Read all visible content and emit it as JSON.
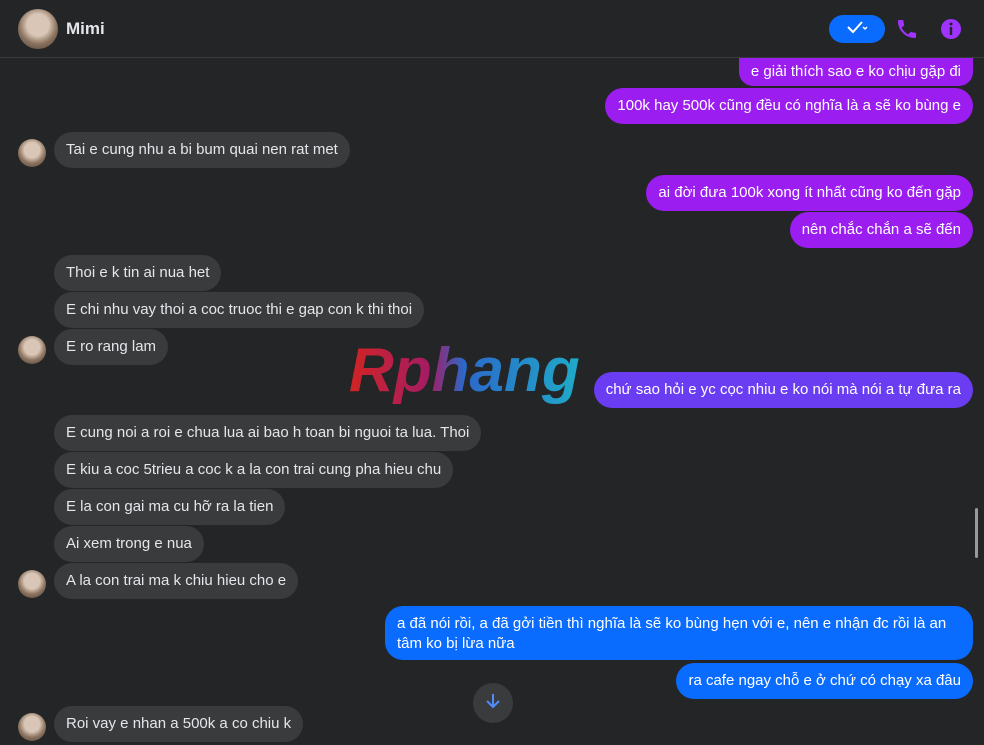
{
  "header": {
    "contact_name": "Mimi"
  },
  "icons": {
    "check": "check-icon",
    "phone": "phone-icon",
    "info": "info-icon",
    "arrow_down": "arrow-down-icon"
  },
  "colors": {
    "accent_blue": "#0a6cff",
    "accent_purple": "#9b1df0",
    "background": "#242526",
    "incoming_bubble": "#3a3b3c"
  },
  "watermark": "Rphang",
  "messages": [
    {
      "text": "e giải thích sao e ko chịu gặp đi"
    },
    {
      "text": "100k hay 500k cũng đều có nghĩa là a sẽ ko bùng e"
    },
    {
      "text": "Tai e cung nhu a bi bum quai nen rat met"
    },
    {
      "text": "ai đời đưa 100k xong ít nhất cũng ko đến gặp"
    },
    {
      "text": "nên chắc chắn a sẽ đến"
    },
    {
      "text": "Thoi e k tin ai nua het"
    },
    {
      "text": "E chi nhu vay thoi a coc truoc thi e gap con k thi thoi"
    },
    {
      "text": "E ro rang lam"
    },
    {
      "text": "chứ sao hỏi e yc cọc nhiu e ko nói mà nói a tự đưa ra"
    },
    {
      "text": "E cung noi a roi e chua lua ai bao h toan bi nguoi ta lua. Thoi"
    },
    {
      "text": "E kiu a coc 5trieu a coc k a la con trai cung pha hieu chu"
    },
    {
      "text": "E la con gai ma cu hỡ ra la tien"
    },
    {
      "text": "Ai xem trong e nua"
    },
    {
      "text": "A la con trai  ma k chiu hieu cho e"
    },
    {
      "text": "a đã nói rồi, a đã gởi tiền thì nghĩa là sẽ ko bùng hẹn với e, nên e nhận đc rồi là an tâm ko bị lừa nữa"
    },
    {
      "text": "ra cafe ngay chỗ e ở chứ có chạy xa đâu"
    },
    {
      "text": "Roi vay e nhan a 500k a co chiu k"
    }
  ]
}
